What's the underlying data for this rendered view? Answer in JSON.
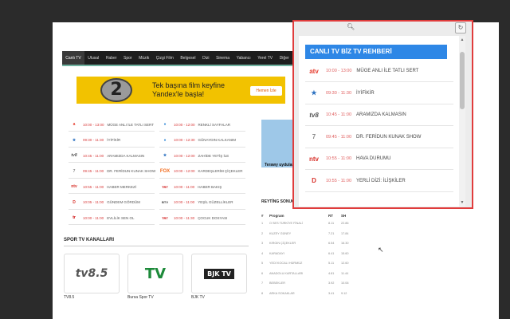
{
  "nav": {
    "items": [
      "Canlı TV",
      "Ulusal",
      "Haber",
      "Spor",
      "Müzik",
      "Çizgi Film",
      "Belgesel",
      "Dizi",
      "Sinema",
      "Yabancı",
      "Yerel TV",
      "Diğer"
    ],
    "active_index": 0
  },
  "banner": {
    "line1": "Tek başına film keyfine",
    "line2": "Yandex'le başla!",
    "button": "Hemen İzle",
    "digit": "2"
  },
  "schedule_left": [
    {
      "logo": "a",
      "time": "10:00 - 13:00",
      "program": "MÜGE ANLI İLE TATLI SERT"
    },
    {
      "logo": "★",
      "time": "09:30 - 11:30",
      "program": "İYİFİKİR"
    },
    {
      "logo": "tv8",
      "time": "10:45 - 11:00",
      "program": "ARAMIZDA KALMASIN"
    },
    {
      "logo": "7",
      "time": "09:45 - 11:00",
      "program": "DR. FERİDUN KUNAK SHOW"
    },
    {
      "logo": "ntv",
      "time": "10:55 - 11:00",
      "program": "HABER MERKEZİ"
    },
    {
      "logo": "D",
      "time": "10:05 - 11:00",
      "program": "GÜNDEM GÖRDÜM"
    },
    {
      "logo": "tr",
      "time": "10:00 - 11:00",
      "program": "EVLİLİK SEN OL"
    }
  ],
  "schedule_right": [
    {
      "logo": "●",
      "time": "10:00 - 12:00",
      "program": "RENKLİ SAYFALAR"
    },
    {
      "logo": "●",
      "time": "10:00 - 12:30",
      "program": "GÜNAYDIN KALKANIM"
    },
    {
      "logo": "★",
      "time": "10:00 - 12:00",
      "program": "ZAHİDE YETİŞ İLE"
    },
    {
      "logo": "FOX",
      "time": "10:00 - 12:00",
      "program": "KARDEŞLERİM ÇİÇEKLER"
    },
    {
      "logo": "TRT",
      "time": "10:00 - 11:00",
      "program": "HABER BAKIŞ"
    },
    {
      "logo": "BTV",
      "time": "10:00 - 11:00",
      "program": "YEŞİL GÜZELLİKLER"
    },
    {
      "logo": "TRT",
      "time": "10:00 - 11:30",
      "program": "ÇOCUK DOSYASI"
    }
  ],
  "sports": {
    "title": "SPOR TV KANALLARI",
    "cards": [
      {
        "logo": "tv8.5",
        "label": "TV8.5"
      },
      {
        "logo": "TV",
        "label": "Bursa Spor TV"
      },
      {
        "logo": "BJK TV",
        "label": "BJK TV"
      }
    ]
  },
  "news": {
    "caption": "Terawy uydular..."
  },
  "rating": {
    "title": "REYTİNG SONUÇLARI",
    "headers": [
      "#",
      "Program",
      "RT",
      "SH"
    ],
    "rows": [
      [
        "1",
        "O SES TÜRKİYE FİNALİ",
        "8.11",
        "22.86"
      ],
      [
        "2",
        "KUZEY GÜNEY",
        "7.21",
        "17.84"
      ],
      [
        "3",
        "KIRGIN ÇİÇEKLER",
        "6.54",
        "16.30"
      ],
      [
        "4",
        "KARADAYI",
        "6.41",
        "15.60"
      ],
      [
        "5",
        "YEDİ KOCALI HÜRMÜZ",
        "5.11",
        "12.60"
      ],
      [
        "6",
        "ANADOLU KARTALLARI",
        "4.81",
        "11.44"
      ],
      [
        "7",
        "BEBEKLER",
        "3.92",
        "10.06"
      ],
      [
        "8",
        "ARKA SOKAKLAR",
        "3.41",
        "9.12"
      ]
    ]
  },
  "popup": {
    "header": "CANLI TV BİZ TV REHBERİ",
    "rows": [
      {
        "logo": "atv",
        "time": "10:00 - 13:00",
        "program": "MÜGE ANLI İLE TATLI SERT"
      },
      {
        "logo": "★",
        "time": "09:30 - 11:30",
        "program": "İYİFİKİR"
      },
      {
        "logo": "tv8",
        "time": "10:45 - 11:00",
        "program": "ARAMIZDA KALMASIN"
      },
      {
        "logo": "7",
        "time": "09:45 - 11:00",
        "program": "DR. FERİDUN KUNAK SHOW"
      },
      {
        "logo": "ntv",
        "time": "10:55 - 11:00",
        "program": "HAVA DURUMU"
      },
      {
        "logo": "D",
        "time": "10:55 - 11:00",
        "program": "YERLİ DİZİ: İLİŞKİLER"
      }
    ]
  },
  "colors": {
    "popup_header": "#2e87e6",
    "popup_border": "#e03c3c",
    "time": "#e06060",
    "banner": "#f2c200"
  }
}
